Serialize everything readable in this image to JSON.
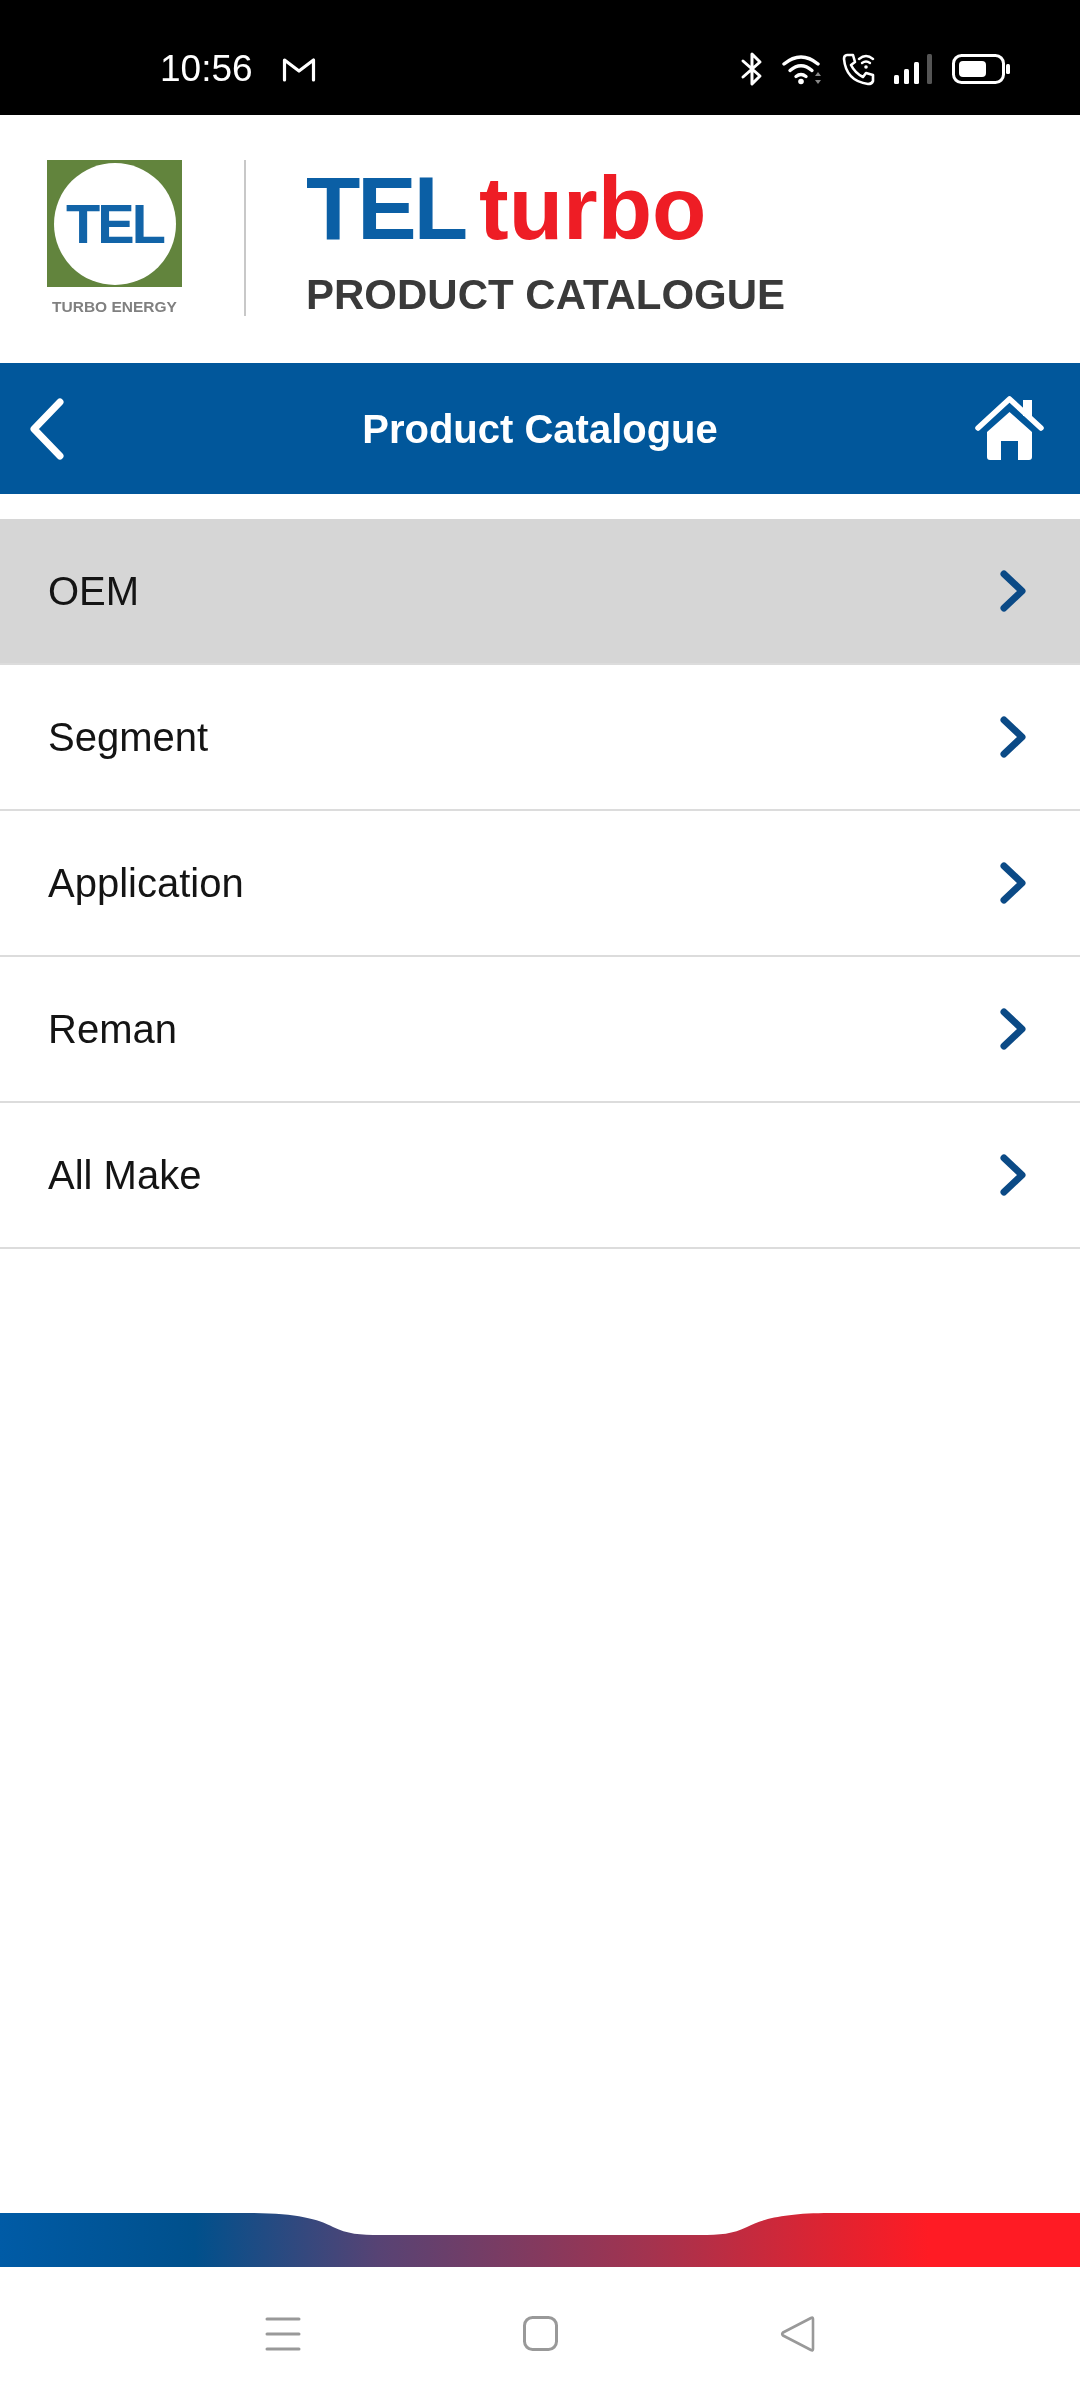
{
  "status_bar": {
    "time": "10:56"
  },
  "header": {
    "logo": {
      "text": "TEL",
      "caption": "TURBO ENERGY"
    },
    "brand": {
      "primary": "TEL",
      "secondary": "turbo"
    },
    "subtitle": "PRODUCT CATALOGUE"
  },
  "toolbar": {
    "title": "Product Catalogue"
  },
  "menu": [
    {
      "label": "OEM",
      "selected": true
    },
    {
      "label": "Segment",
      "selected": false
    },
    {
      "label": "Application",
      "selected": false
    },
    {
      "label": "Reman",
      "selected": false
    },
    {
      "label": "All Make",
      "selected": false
    }
  ]
}
